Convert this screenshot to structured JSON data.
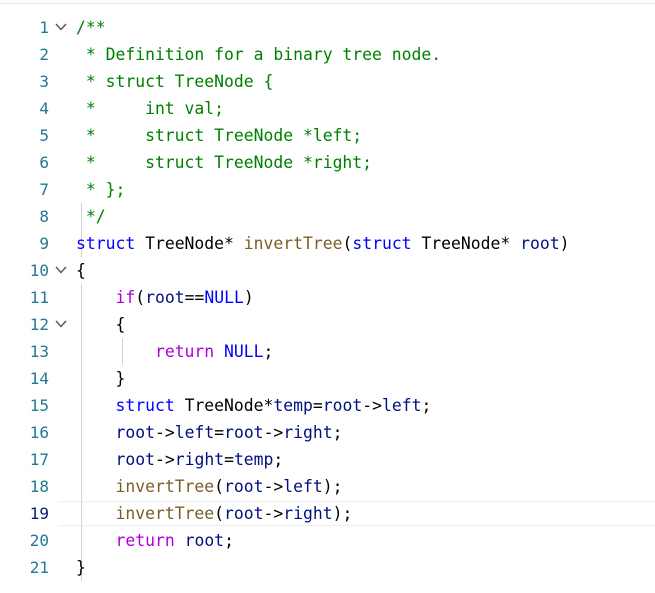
{
  "editor": {
    "lines": [
      {
        "n": "1",
        "tokens": [
          {
            "t": "/**",
            "c": "comment"
          }
        ],
        "fold": true
      },
      {
        "n": "2",
        "tokens": [
          {
            "t": " * Definition for a binary tree node.",
            "c": "comment"
          }
        ]
      },
      {
        "n": "3",
        "tokens": [
          {
            "t": " * struct TreeNode {",
            "c": "comment"
          }
        ]
      },
      {
        "n": "4",
        "tokens": [
          {
            "t": " *     int val;",
            "c": "comment"
          }
        ]
      },
      {
        "n": "5",
        "tokens": [
          {
            "t": " *     struct TreeNode *left;",
            "c": "comment"
          }
        ]
      },
      {
        "n": "6",
        "tokens": [
          {
            "t": " *     struct TreeNode *right;",
            "c": "comment"
          }
        ]
      },
      {
        "n": "7",
        "tokens": [
          {
            "t": " * };",
            "c": "comment"
          }
        ]
      },
      {
        "n": "8",
        "tokens": [
          {
            "t": " */",
            "c": "comment"
          }
        ]
      },
      {
        "n": "9",
        "tokens": [
          {
            "t": "struct",
            "c": "kw"
          },
          {
            "t": " TreeNode",
            "c": ""
          },
          {
            "t": "* ",
            "c": ""
          },
          {
            "t": "invertTree",
            "c": "fn"
          },
          {
            "t": "(",
            "c": ""
          },
          {
            "t": "struct",
            "c": "kw"
          },
          {
            "t": " TreeNode",
            "c": ""
          },
          {
            "t": "* ",
            "c": ""
          },
          {
            "t": "root",
            "c": "var"
          },
          {
            "t": ")",
            "c": ""
          }
        ]
      },
      {
        "n": "10",
        "tokens": [
          {
            "t": "{",
            "c": ""
          }
        ],
        "fold": true
      },
      {
        "n": "11",
        "tokens": [
          {
            "t": "    ",
            "c": ""
          },
          {
            "t": "if",
            "c": "ctrl"
          },
          {
            "t": "(",
            "c": ""
          },
          {
            "t": "root",
            "c": "var"
          },
          {
            "t": "==",
            "c": ""
          },
          {
            "t": "NULL",
            "c": "kw"
          },
          {
            "t": ")",
            "c": ""
          }
        ]
      },
      {
        "n": "12",
        "tokens": [
          {
            "t": "    {",
            "c": ""
          }
        ],
        "fold": true
      },
      {
        "n": "13",
        "tokens": [
          {
            "t": "        ",
            "c": ""
          },
          {
            "t": "return",
            "c": "ctrl"
          },
          {
            "t": " ",
            "c": ""
          },
          {
            "t": "NULL",
            "c": "kw"
          },
          {
            "t": ";",
            "c": ""
          }
        ]
      },
      {
        "n": "14",
        "tokens": [
          {
            "t": "    }",
            "c": ""
          }
        ]
      },
      {
        "n": "15",
        "tokens": [
          {
            "t": "    ",
            "c": ""
          },
          {
            "t": "struct",
            "c": "kw"
          },
          {
            "t": " TreeNode",
            "c": ""
          },
          {
            "t": "*",
            "c": ""
          },
          {
            "t": "temp",
            "c": "var"
          },
          {
            "t": "=",
            "c": ""
          },
          {
            "t": "root",
            "c": "var"
          },
          {
            "t": "->",
            "c": ""
          },
          {
            "t": "left",
            "c": "var"
          },
          {
            "t": ";",
            "c": ""
          }
        ]
      },
      {
        "n": "16",
        "tokens": [
          {
            "t": "    ",
            "c": ""
          },
          {
            "t": "root",
            "c": "var"
          },
          {
            "t": "->",
            "c": ""
          },
          {
            "t": "left",
            "c": "var"
          },
          {
            "t": "=",
            "c": ""
          },
          {
            "t": "root",
            "c": "var"
          },
          {
            "t": "->",
            "c": ""
          },
          {
            "t": "right",
            "c": "var"
          },
          {
            "t": ";",
            "c": ""
          }
        ]
      },
      {
        "n": "17",
        "tokens": [
          {
            "t": "    ",
            "c": ""
          },
          {
            "t": "root",
            "c": "var"
          },
          {
            "t": "->",
            "c": ""
          },
          {
            "t": "right",
            "c": "var"
          },
          {
            "t": "=",
            "c": ""
          },
          {
            "t": "temp",
            "c": "var"
          },
          {
            "t": ";",
            "c": ""
          }
        ]
      },
      {
        "n": "18",
        "tokens": [
          {
            "t": "    ",
            "c": ""
          },
          {
            "t": "invertTree",
            "c": "fn"
          },
          {
            "t": "(",
            "c": ""
          },
          {
            "t": "root",
            "c": "var"
          },
          {
            "t": "->",
            "c": ""
          },
          {
            "t": "left",
            "c": "var"
          },
          {
            "t": ");",
            "c": ""
          }
        ]
      },
      {
        "n": "19",
        "tokens": [
          {
            "t": "    ",
            "c": ""
          },
          {
            "t": "invertTree",
            "c": "fn"
          },
          {
            "t": "(",
            "c": ""
          },
          {
            "t": "root",
            "c": "var"
          },
          {
            "t": "->",
            "c": ""
          },
          {
            "t": "right",
            "c": "var"
          },
          {
            "t": ");",
            "c": ""
          }
        ],
        "current": true
      },
      {
        "n": "20",
        "tokens": [
          {
            "t": "    ",
            "c": ""
          },
          {
            "t": "return",
            "c": "ctrl"
          },
          {
            "t": " ",
            "c": ""
          },
          {
            "t": "root",
            "c": "var"
          },
          {
            "t": ";",
            "c": ""
          }
        ]
      },
      {
        "n": "21",
        "tokens": [
          {
            "t": "}",
            "c": ""
          }
        ]
      }
    ]
  },
  "colors": {
    "comment": "#008000",
    "keyword": "#0000ff",
    "control": "#af00db",
    "function": "#795e26",
    "variable": "#001080",
    "line_number": "#237893"
  },
  "icons": {
    "fold": "chevron-down-icon"
  }
}
